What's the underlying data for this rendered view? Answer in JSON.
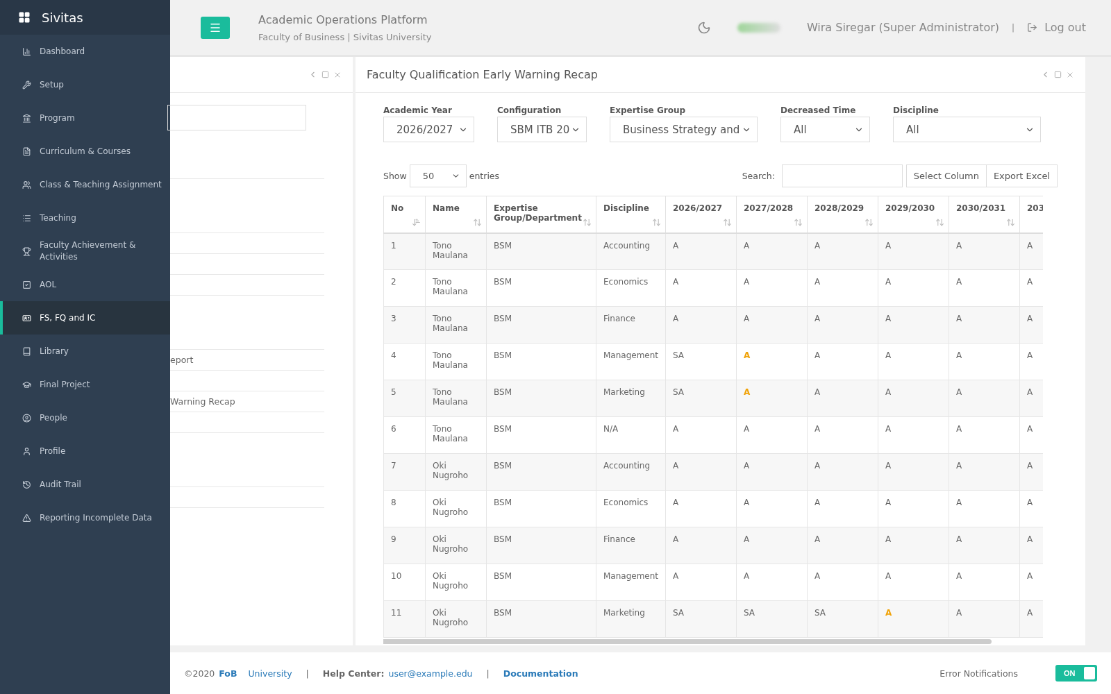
{
  "brand": "Sivitas",
  "header": {
    "title": "Academic Operations Platform",
    "subtitle": "Faculty of Business | Sivitas University",
    "user": "Wira Siregar (Super Administrator)",
    "separator": "|",
    "logout": "Log out"
  },
  "sidebar": {
    "items": [
      {
        "label": "Dashboard",
        "selected": false
      },
      {
        "label": "Setup",
        "selected": false
      },
      {
        "label": "Program",
        "selected": false
      },
      {
        "label": "Curriculum & Courses",
        "selected": false
      },
      {
        "label": "Class & Teaching Assignment",
        "selected": false
      },
      {
        "label": "Teaching",
        "selected": false
      },
      {
        "label": "Faculty Achievement & Activities",
        "selected": false
      },
      {
        "label": "AOL",
        "selected": false
      },
      {
        "label": "FS, FQ and IC",
        "selected": true
      },
      {
        "label": "Library",
        "selected": false
      },
      {
        "label": "Final Project",
        "selected": false
      },
      {
        "label": "People",
        "selected": false
      },
      {
        "label": "Profile",
        "selected": false
      },
      {
        "label": "Audit Trail",
        "selected": false
      },
      {
        "label": "Reporting Incomplete Data",
        "selected": false
      }
    ]
  },
  "back_panel": {
    "items": [
      {
        "text": "eport"
      },
      {
        "text": "Warning Recap"
      }
    ]
  },
  "panel": {
    "title": "Faculty Qualification Early Warning Recap",
    "filters": [
      {
        "label": "Academic Year",
        "value": "2026/2027"
      },
      {
        "label": "Configuration",
        "value": "SBM ITB 20"
      },
      {
        "label": "Expertise Group",
        "value": "Business Strategy and"
      },
      {
        "label": "Decreased Time",
        "value": "All"
      },
      {
        "label": "Discipline",
        "value": "All"
      }
    ],
    "show_label": "Show",
    "entries_value": "50",
    "entries_label": "entries",
    "search_label": "Search:",
    "buttons": [
      "Select Column",
      "Export Excel"
    ],
    "table": {
      "columns": [
        "No",
        "Name",
        "Expertise Group/Department",
        "Discipline",
        "2026/2027",
        "2027/2028",
        "2028/2029",
        "2029/2030",
        "2030/2031",
        "203"
      ],
      "rows": [
        {
          "no": "1",
          "name": "Tono Maulana",
          "group": "BSM",
          "discipline": "Accounting",
          "values": [
            {
              "text": "A",
              "warn": false
            },
            {
              "text": "A",
              "warn": false
            },
            {
              "text": "A",
              "warn": false
            },
            {
              "text": "A",
              "warn": false
            },
            {
              "text": "A",
              "warn": false
            },
            {
              "text": "A",
              "warn": false
            }
          ]
        },
        {
          "no": "2",
          "name": "Tono Maulana",
          "group": "BSM",
          "discipline": "Economics",
          "values": [
            {
              "text": "A",
              "warn": false
            },
            {
              "text": "A",
              "warn": false
            },
            {
              "text": "A",
              "warn": false
            },
            {
              "text": "A",
              "warn": false
            },
            {
              "text": "A",
              "warn": false
            },
            {
              "text": "A",
              "warn": false
            }
          ]
        },
        {
          "no": "3",
          "name": "Tono Maulana",
          "group": "BSM",
          "discipline": "Finance",
          "values": [
            {
              "text": "A",
              "warn": false
            },
            {
              "text": "A",
              "warn": false
            },
            {
              "text": "A",
              "warn": false
            },
            {
              "text": "A",
              "warn": false
            },
            {
              "text": "A",
              "warn": false
            },
            {
              "text": "A",
              "warn": false
            }
          ]
        },
        {
          "no": "4",
          "name": "Tono Maulana",
          "group": "BSM",
          "discipline": "Management",
          "values": [
            {
              "text": "SA",
              "warn": false
            },
            {
              "text": "A",
              "warn": true
            },
            {
              "text": "A",
              "warn": false
            },
            {
              "text": "A",
              "warn": false
            },
            {
              "text": "A",
              "warn": false
            },
            {
              "text": "A",
              "warn": false
            }
          ]
        },
        {
          "no": "5",
          "name": "Tono Maulana",
          "group": "BSM",
          "discipline": "Marketing",
          "values": [
            {
              "text": "SA",
              "warn": false
            },
            {
              "text": "A",
              "warn": true
            },
            {
              "text": "A",
              "warn": false
            },
            {
              "text": "A",
              "warn": false
            },
            {
              "text": "A",
              "warn": false
            },
            {
              "text": "A",
              "warn": false
            }
          ]
        },
        {
          "no": "6",
          "name": "Tono Maulana",
          "group": "BSM",
          "discipline": "N/A",
          "values": [
            {
              "text": "A",
              "warn": false
            },
            {
              "text": "A",
              "warn": false
            },
            {
              "text": "A",
              "warn": false
            },
            {
              "text": "A",
              "warn": false
            },
            {
              "text": "A",
              "warn": false
            },
            {
              "text": "A",
              "warn": false
            }
          ]
        },
        {
          "no": "7",
          "name": "Oki Nugroho",
          "group": "BSM",
          "discipline": "Accounting",
          "values": [
            {
              "text": "A",
              "warn": false
            },
            {
              "text": "A",
              "warn": false
            },
            {
              "text": "A",
              "warn": false
            },
            {
              "text": "A",
              "warn": false
            },
            {
              "text": "A",
              "warn": false
            },
            {
              "text": "A",
              "warn": false
            }
          ]
        },
        {
          "no": "8",
          "name": "Oki Nugroho",
          "group": "BSM",
          "discipline": "Economics",
          "values": [
            {
              "text": "A",
              "warn": false
            },
            {
              "text": "A",
              "warn": false
            },
            {
              "text": "A",
              "warn": false
            },
            {
              "text": "A",
              "warn": false
            },
            {
              "text": "A",
              "warn": false
            },
            {
              "text": "A",
              "warn": false
            }
          ]
        },
        {
          "no": "9",
          "name": "Oki Nugroho",
          "group": "BSM",
          "discipline": "Finance",
          "values": [
            {
              "text": "A",
              "warn": false
            },
            {
              "text": "A",
              "warn": false
            },
            {
              "text": "A",
              "warn": false
            },
            {
              "text": "A",
              "warn": false
            },
            {
              "text": "A",
              "warn": false
            },
            {
              "text": "A",
              "warn": false
            }
          ]
        },
        {
          "no": "10",
          "name": "Oki Nugroho",
          "group": "BSM",
          "discipline": "Management",
          "values": [
            {
              "text": "A",
              "warn": false
            },
            {
              "text": "A",
              "warn": false
            },
            {
              "text": "A",
              "warn": false
            },
            {
              "text": "A",
              "warn": false
            },
            {
              "text": "A",
              "warn": false
            },
            {
              "text": "A",
              "warn": false
            }
          ]
        },
        {
          "no": "11",
          "name": "Oki Nugroho",
          "group": "BSM",
          "discipline": "Marketing",
          "values": [
            {
              "text": "SA",
              "warn": false
            },
            {
              "text": "SA",
              "warn": false
            },
            {
              "text": "SA",
              "warn": false
            },
            {
              "text": "A",
              "warn": true
            },
            {
              "text": "A",
              "warn": false
            },
            {
              "text": "A",
              "warn": false
            }
          ]
        }
      ]
    }
  },
  "footer": {
    "copyright": "©2020",
    "fob": "FoB",
    "university": "University",
    "sep": "|",
    "help_label": "Help Center:",
    "email": "user@example.edu",
    "docs": "Documentation",
    "error_label": "Error Notifications",
    "error_toggle": {
      "label": "ON",
      "on": true
    }
  }
}
